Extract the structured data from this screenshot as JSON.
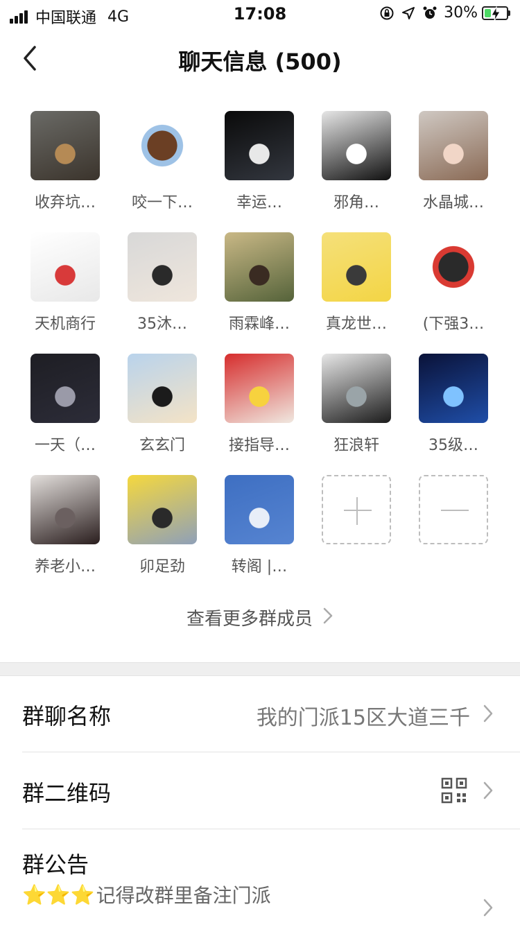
{
  "status_bar": {
    "carrier": "中国联通",
    "network": "4G",
    "time": "17:08",
    "battery_pct": "30%",
    "battery_level": 0.3
  },
  "nav": {
    "title": "聊天信息 (500)",
    "back_icon": "chevron-left-icon"
  },
  "members": [
    {
      "name": "收弃坑…",
      "avatar_colors": [
        "#6a6a66",
        "#3b342c",
        "#b58a55"
      ]
    },
    {
      "name": "咬一下…",
      "avatar_colors": [
        "#ffffff",
        "#9ec2e6",
        "#6b3f24"
      ]
    },
    {
      "name": "幸运…",
      "avatar_colors": [
        "#0a0a0a",
        "#33373f",
        "#e8e8e8"
      ]
    },
    {
      "name": "邪角…",
      "avatar_colors": [
        "#e6e6e6",
        "#111111",
        "#ffffff"
      ]
    },
    {
      "name": "水晶城…",
      "avatar_colors": [
        "#cfc8c2",
        "#8a6a55",
        "#f1d6c7"
      ]
    },
    {
      "name": "天机商行",
      "avatar_colors": [
        "#ffffff",
        "#e8e8e8",
        "#d83a3a"
      ]
    },
    {
      "name": "35沐…",
      "avatar_colors": [
        "#d8d8d8",
        "#efe6dc",
        "#2a2a2a"
      ]
    },
    {
      "name": "雨霖峰…",
      "avatar_colors": [
        "#c9b886",
        "#55633a",
        "#3a2b22"
      ]
    },
    {
      "name": "真龙世…",
      "avatar_colors": [
        "#f5e07a",
        "#f3d545",
        "#3a3a3a"
      ]
    },
    {
      "name": "(下强3…",
      "avatar_colors": [
        "#ffffff",
        "#d93a32",
        "#2a2a2a"
      ]
    },
    {
      "name": "一天（…",
      "avatar_colors": [
        "#1e1e24",
        "#2c2c38",
        "#9a9aa8"
      ]
    },
    {
      "name": "玄玄门",
      "avatar_colors": [
        "#b9d3ec",
        "#f4e3c6",
        "#1b1b1b"
      ]
    },
    {
      "name": "接指导…",
      "avatar_colors": [
        "#d62d2d",
        "#f0e8e0",
        "#f7d23e"
      ]
    },
    {
      "name": "狂浪轩",
      "avatar_colors": [
        "#e7e7e7",
        "#1c1c1c",
        "#9aa4a8"
      ]
    },
    {
      "name": "35级…",
      "avatar_colors": [
        "#0a1238",
        "#1f4ea8",
        "#7fc2ff"
      ]
    },
    {
      "name": "养老小…",
      "avatar_colors": [
        "#e3dfdc",
        "#2a1e1e",
        "#6b6060"
      ]
    },
    {
      "name": "卯足劲",
      "avatar_colors": [
        "#f5d83e",
        "#8fa0b8",
        "#2a2a2a"
      ]
    },
    {
      "name": "转阁 |…",
      "avatar_colors": [
        "#3e6fc2",
        "#5684d1",
        "#e8eef8"
      ]
    }
  ],
  "add_member_icon": "plus-icon",
  "remove_member_icon": "minus-icon",
  "more_members": {
    "label": "查看更多群成员",
    "icon": "chevron-right-icon"
  },
  "rows": {
    "group_name": {
      "label": "群聊名称",
      "value": "我的门派15区大道三千"
    },
    "qr_code": {
      "label": "群二维码",
      "icon": "qr-code-icon"
    },
    "announcement": {
      "label": "群公告",
      "stars": "⭐⭐⭐",
      "text": "记得改群里备注门派"
    }
  },
  "colors": {
    "text_primary": "#111111",
    "text_secondary": "#777777",
    "divider": "#e2e2e2",
    "separator_bg": "#efefef",
    "battery_green": "#4cd964"
  }
}
